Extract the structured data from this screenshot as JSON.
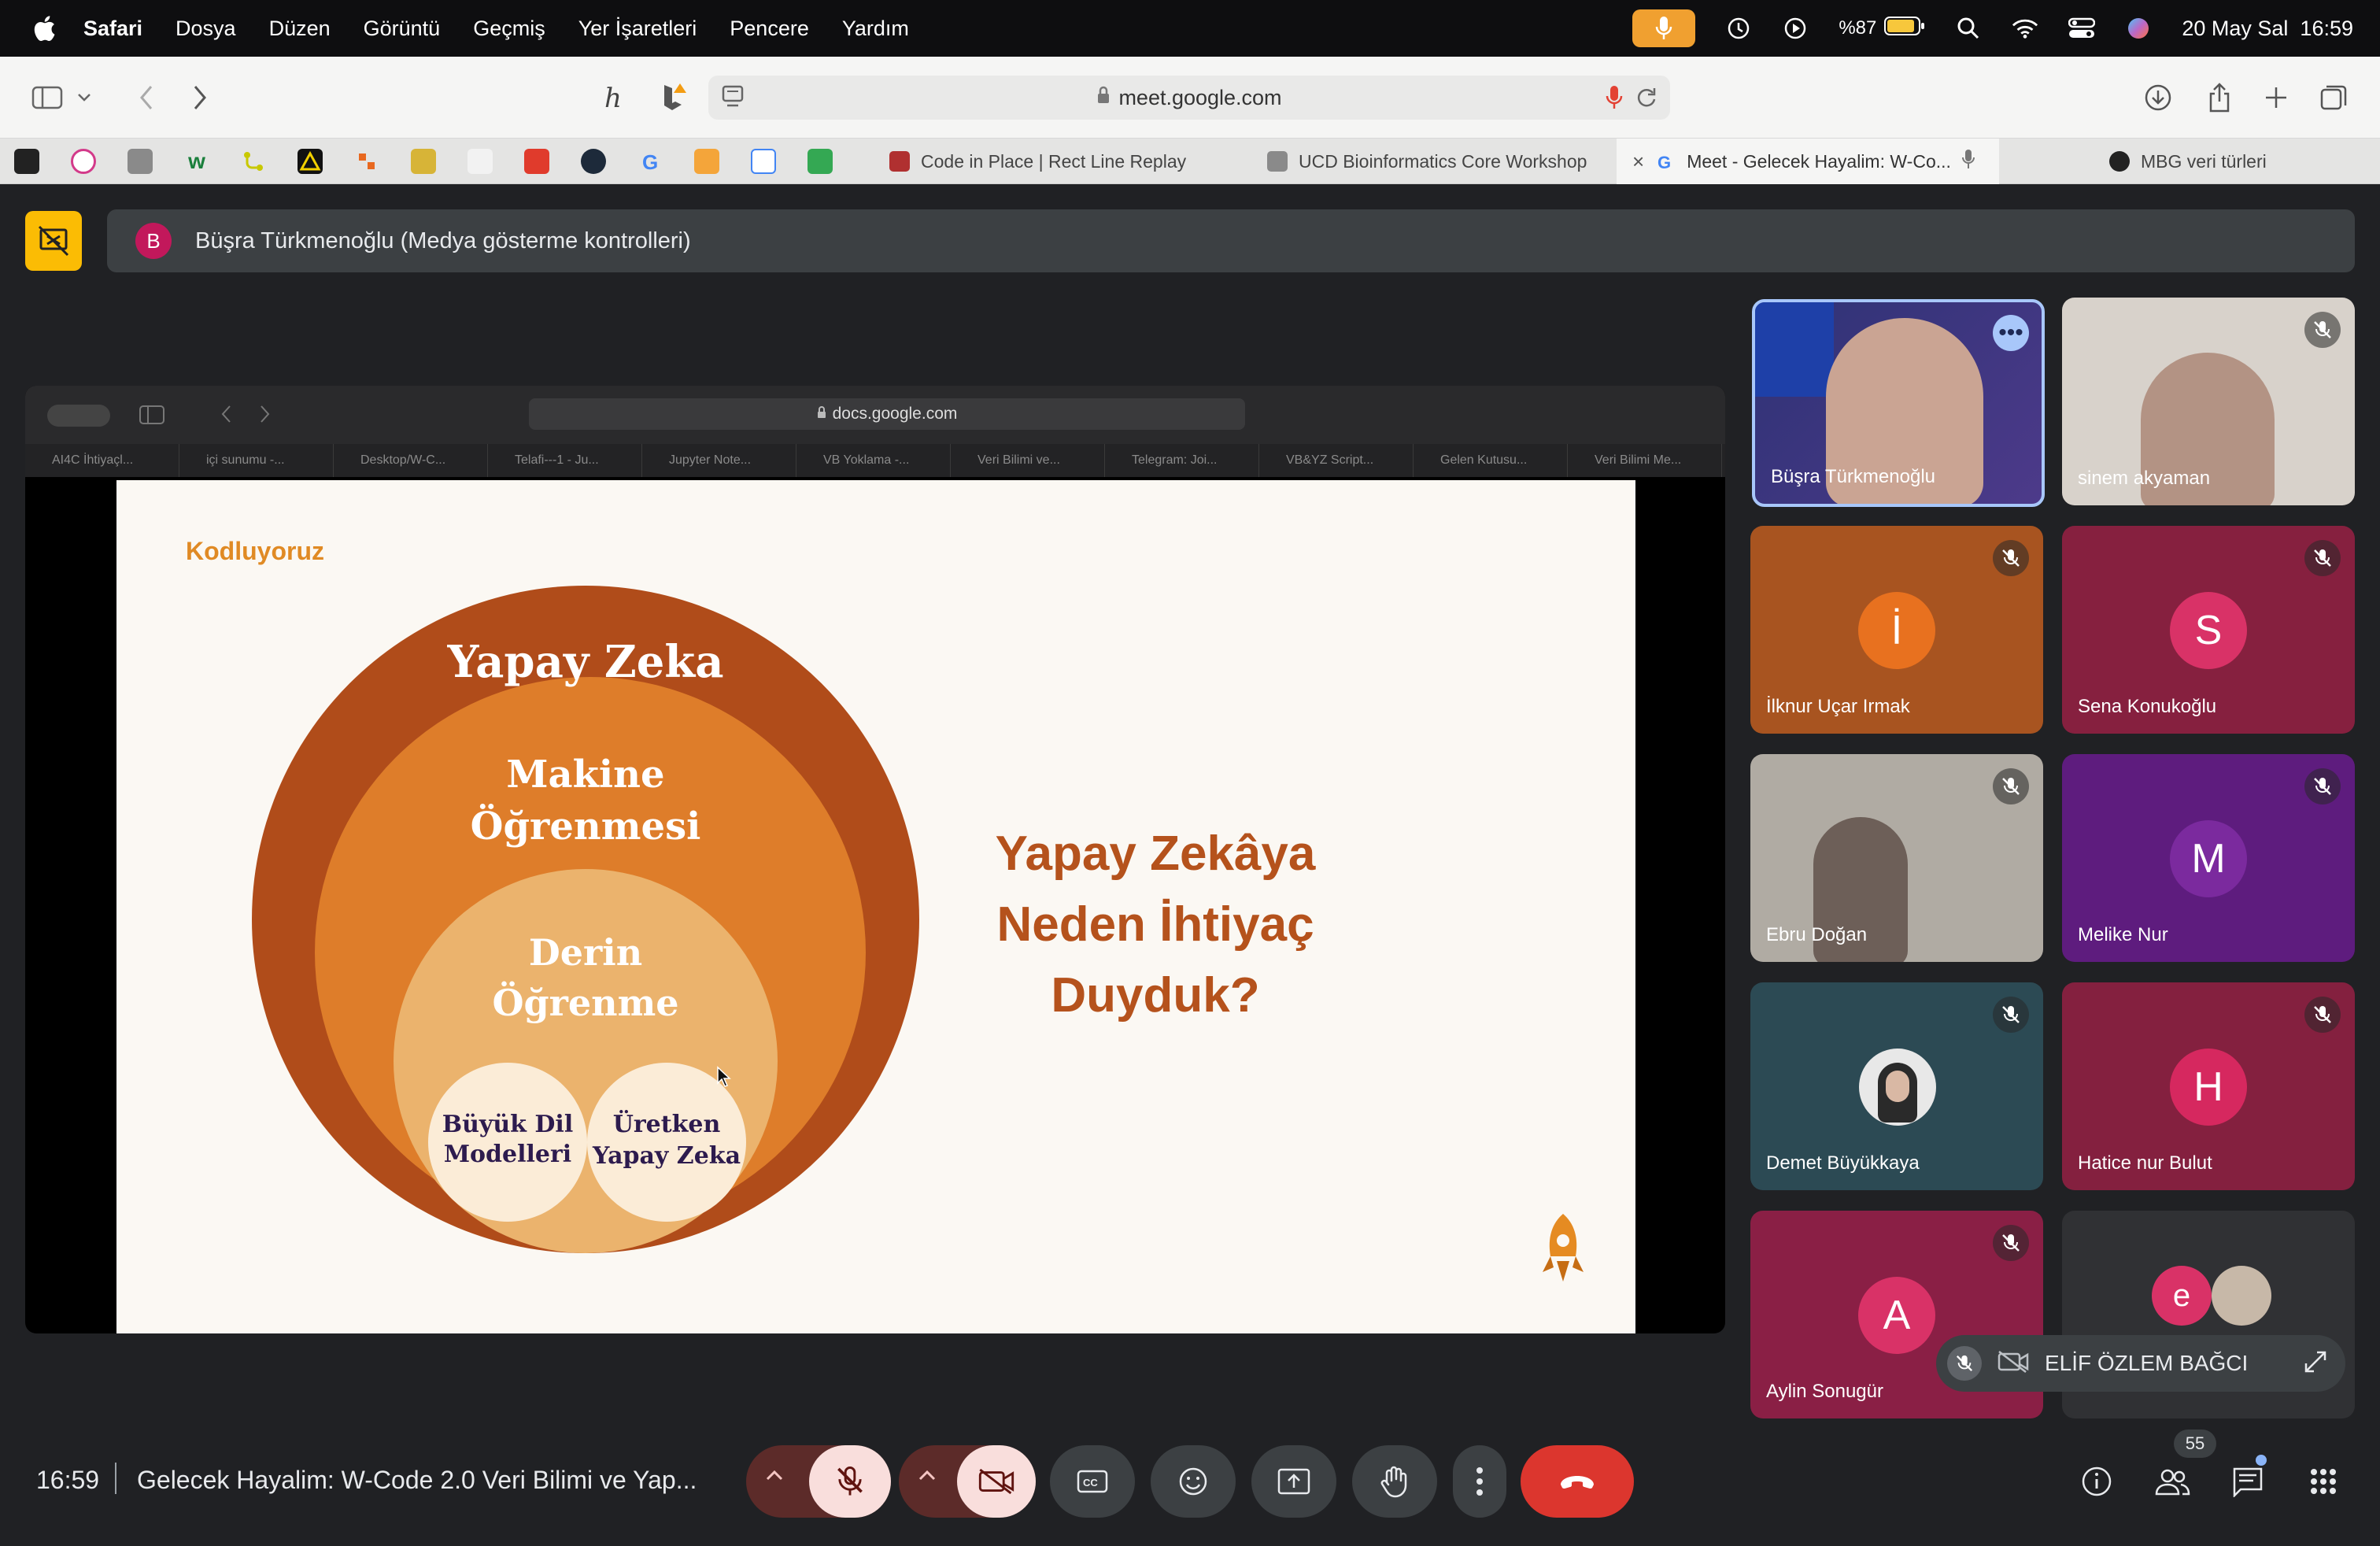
{
  "menubar": {
    "app": "Safari",
    "items": [
      "Dosya",
      "Düzen",
      "Görüntü",
      "Geçmiş",
      "Yer İşaretleri",
      "Pencere",
      "Yardım"
    ],
    "battery": "%87",
    "datetime": "20 May Sal  16:59"
  },
  "browser": {
    "url": "meet.google.com",
    "tabs": [
      {
        "title": "Code in Place | Rect Line Replay"
      },
      {
        "title": "UCD Bioinformatics Core Workshop"
      },
      {
        "title": "Meet - Gelecek Hayalim: W-Co..."
      },
      {
        "title": "MBG veri türleri"
      }
    ]
  },
  "meet": {
    "presentation_banner": "Büşra Türkmenoğlu (Medya gösterme kontrolleri)",
    "presenter_initial": "B",
    "time": "16:59",
    "meeting_title": "Gelecek Hayalim: W-Code 2.0 Veri Bilimi ve Yap...",
    "participant_count": "55",
    "participants": [
      {
        "name": "Büşra Türkmenoğlu",
        "initial": "",
        "color": "#3b3d86"
      },
      {
        "name": "sinem akyaman",
        "initial": "",
        "color": "#cfc9c2"
      },
      {
        "name": "İlknur Uçar Irmak",
        "initial": "İ",
        "color": "#b85f1e"
      },
      {
        "name": "Sena Konukoğlu",
        "initial": "S",
        "color": "#8e1f45"
      },
      {
        "name": "Ebru Doğan",
        "initial": "",
        "color": "#a8a39b"
      },
      {
        "name": "Melike Nur",
        "initial": "M",
        "color": "#6a1b86"
      },
      {
        "name": "Demet Büyükkaya",
        "initial": "",
        "color": "#2e4b55"
      },
      {
        "name": "Hatice nur Bulut",
        "initial": "H",
        "color": "#8a1f45"
      },
      {
        "name": "Aylin Sonugür",
        "initial": "A",
        "color": "#8e1f45"
      },
      {
        "name": "ELİF ÖZLEM BAĞCI",
        "initial": "e",
        "color": "#303134"
      }
    ]
  },
  "shared_screen": {
    "inner_url": "docs.google.com",
    "inner_tabs": [
      "AI4C İhtiyaçl...",
      "içi sunumu -...",
      "Desktop/W-C...",
      "Telafi---1 - Ju...",
      "Jupyter Note...",
      "VB Yoklama -...",
      "Veri Bilimi ve...",
      "Telegram: Joi...",
      "VB&YZ Script...",
      "Gelen Kutusu...",
      "Veri Bilimi Me..."
    ],
    "slide": {
      "brand": "Kodluyoruz",
      "outer": "Yapay Zeka",
      "ml_line1": "Makine",
      "ml_line2": "Öğrenmesi",
      "dl_line1": "Derin",
      "dl_line2": "Öğrenme",
      "llm_line1": "Büyük Dil",
      "llm_line2": "Modelleri",
      "genai_line1": "Üretken",
      "genai_line2": "Yapay Zeka",
      "question_line1": "Yapay Zekâya",
      "question_line2": "Neden İhtiyaç",
      "question_line3": "Duyduk?"
    }
  }
}
